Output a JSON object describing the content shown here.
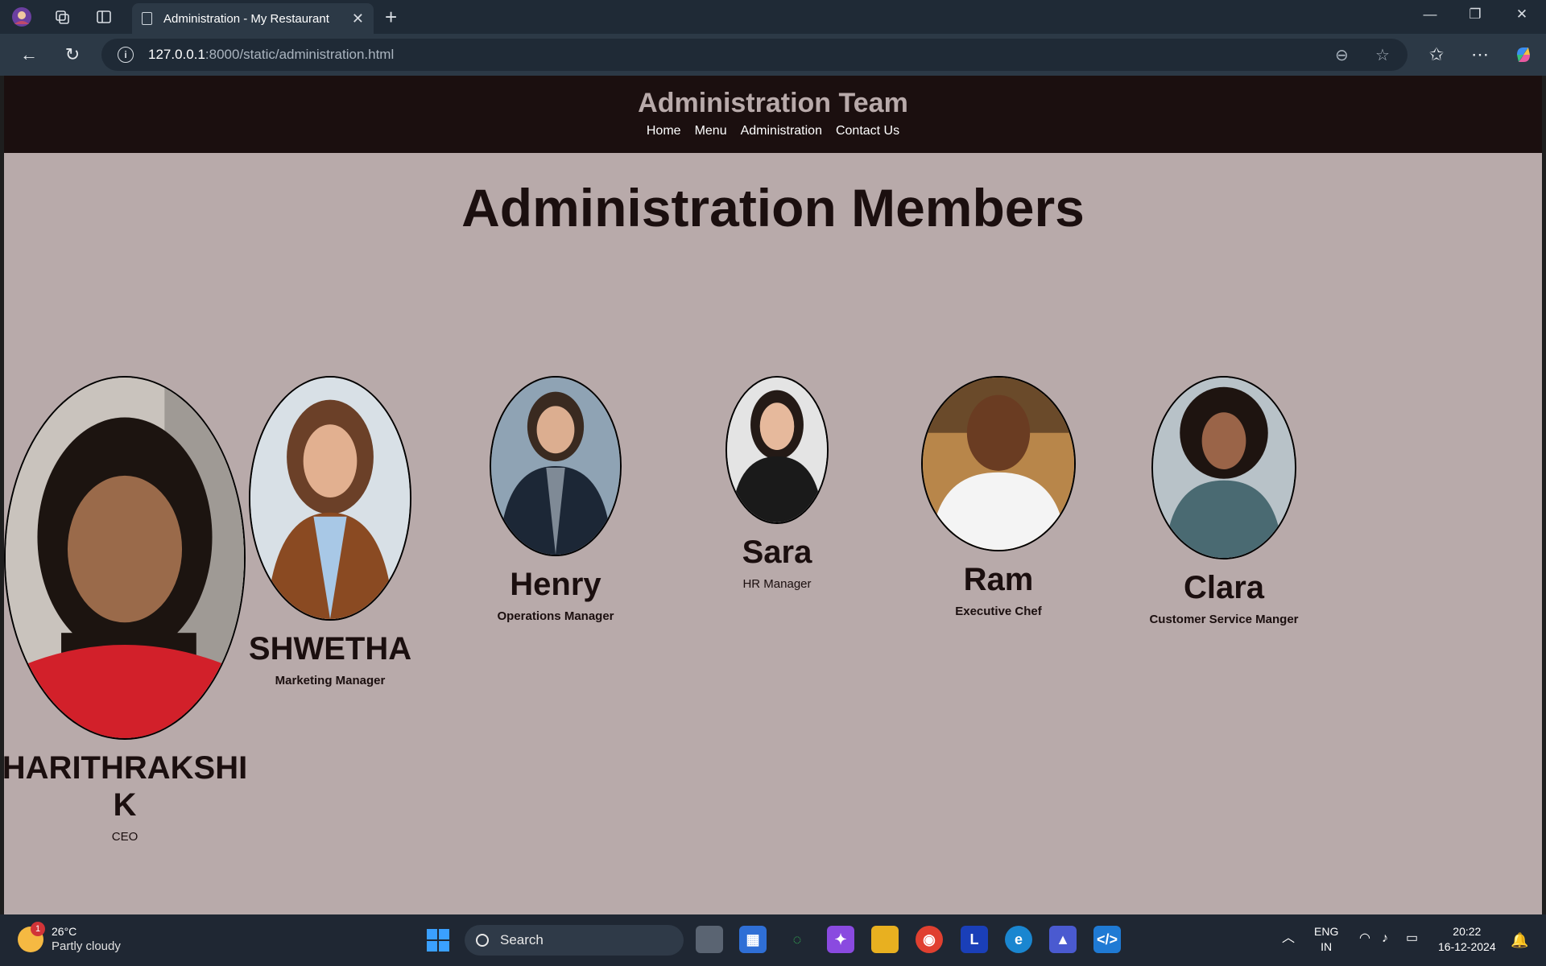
{
  "browser": {
    "tab_title": "Administration - My Restaurant",
    "url_host": "127.0.0.1",
    "url_path": ":8000/static/administration.html"
  },
  "site": {
    "title": "Administration Team",
    "nav": [
      "Home",
      "Menu",
      "Administration",
      "Contact Us"
    ]
  },
  "page": {
    "heading": "Administration Members"
  },
  "members": [
    {
      "name": "HARITHRAKSHI\nK",
      "role": "CEO"
    },
    {
      "name": "SHWETHA",
      "role": "Marketing Manager"
    },
    {
      "name": "Henry",
      "role": "Operations Manager"
    },
    {
      "name": "Sara",
      "role": "HR Manager"
    },
    {
      "name": "Ram",
      "role": "Executive Chef"
    },
    {
      "name": "Clara",
      "role": "Customer Service Manger"
    }
  ],
  "taskbar": {
    "temperature": "26°C",
    "weather": "Partly cloudy",
    "weather_badge": "1",
    "search_label": "Search",
    "lang_top": "ENG",
    "lang_bottom": "IN",
    "time": "20:22",
    "date": "16-12-2024"
  },
  "colors": {
    "header_bg": "#1b0f0f",
    "page_bg": "#b8aaaa",
    "title_color": "#b8aaaa"
  }
}
